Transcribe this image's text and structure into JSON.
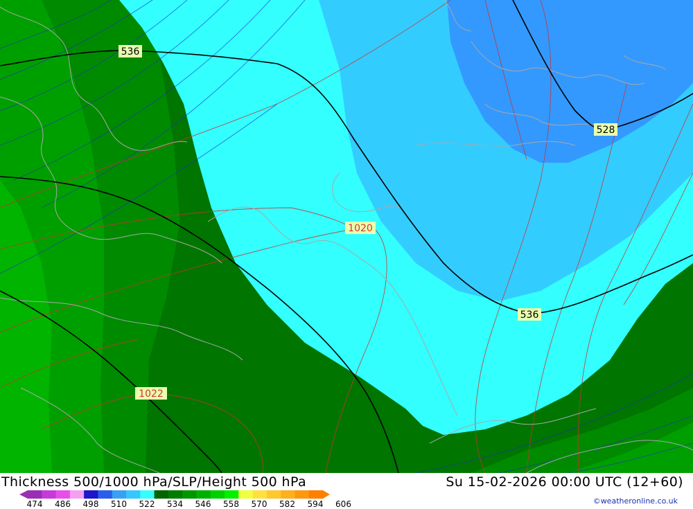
{
  "title": "Thickness 500/1000 hPa/SLP/Height 500 hPa",
  "datetime": "Su 15-02-2026 00:00 UTC (12+60)",
  "credit": "©weatheronline.co.uk",
  "contour_labels": {
    "height_536_top": "536",
    "height_528": "528",
    "height_536_right": "536",
    "slp_1020": "1020",
    "slp_1022": "1022"
  },
  "legend": {
    "ticks": [
      "474",
      "486",
      "498",
      "510",
      "522",
      "534",
      "546",
      "558",
      "570",
      "582",
      "594",
      "606"
    ],
    "colors": [
      "#9a2fb5",
      "#c63bd8",
      "#e84fe8",
      "#f3a0f3",
      "#1e16c8",
      "#2b5ee8",
      "#3aa0f3",
      "#33c8ff",
      "#33ffff",
      "#006400",
      "#007c00",
      "#009600",
      "#00b000",
      "#00d000",
      "#00f000",
      "#f0ff40",
      "#ffe040",
      "#ffc830",
      "#ffb020",
      "#ff9810",
      "#ff8000"
    ]
  },
  "colors": {
    "thickness_528": "#3399ff",
    "thickness_534": "#33ccff",
    "thickness_540": "#33ffff",
    "thickness_546": "#007500",
    "thickness_552": "#009600",
    "thickness_558": "#00b400",
    "label_box": "#e8ffaf"
  }
}
